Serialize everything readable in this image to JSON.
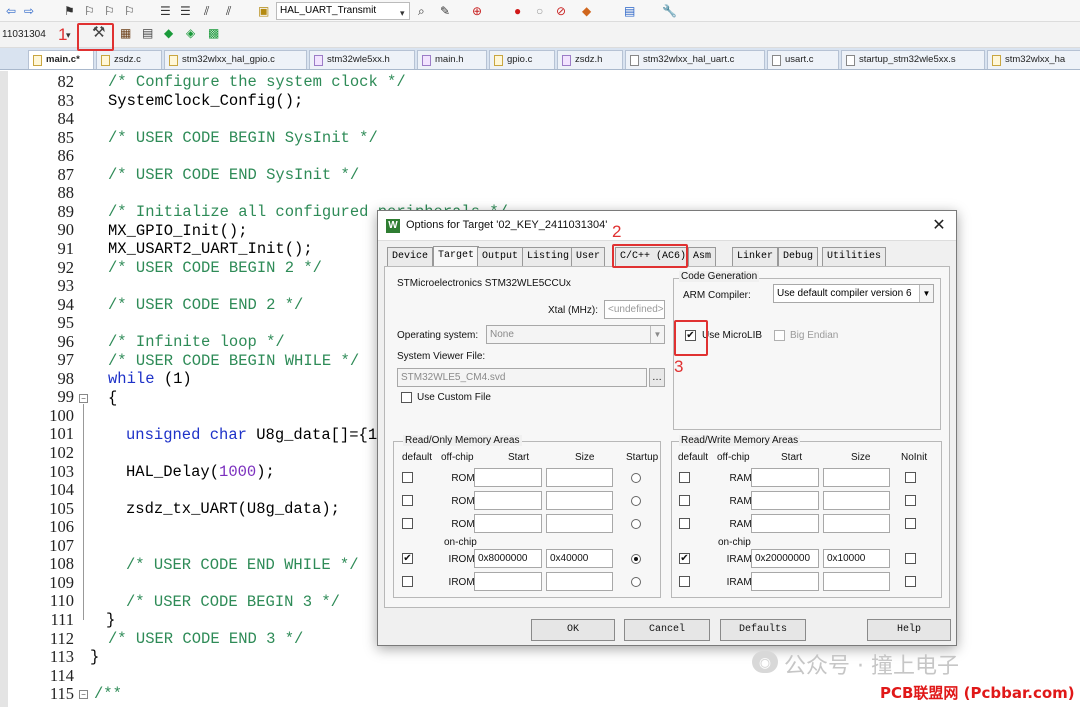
{
  "toolbar1": {
    "target_name": "HAL_UART_Transmit"
  },
  "toolbar2": {
    "target_combo": "11031304"
  },
  "file_tabs": [
    {
      "label": "main.c*",
      "type": "c",
      "active": true
    },
    {
      "label": "zsdz.c",
      "type": "c"
    },
    {
      "label": "stm32wlxx_hal_gpio.c",
      "type": "c"
    },
    {
      "label": "stm32wle5xx.h",
      "type": "h"
    },
    {
      "label": "main.h",
      "type": "h"
    },
    {
      "label": "gpio.c",
      "type": "c"
    },
    {
      "label": "zsdz.h",
      "type": "h"
    },
    {
      "label": "stm32wlxx_hal_uart.c",
      "type": "c"
    },
    {
      "label": "usart.c",
      "type": "c"
    },
    {
      "label": "startup_stm32wle5xx.s",
      "type": "s"
    },
    {
      "label": "stm32wlxx_ha",
      "type": "h"
    }
  ],
  "editor": {
    "line_numbers": [
      "82",
      "83",
      "84",
      "85",
      "86",
      "87",
      "88",
      "89",
      "90",
      "91",
      "92",
      "93",
      "94",
      "95",
      "96",
      "97",
      "98",
      "99",
      "100",
      "101",
      "102",
      "103",
      "104",
      "105",
      "106",
      "107",
      "108",
      "109",
      "110",
      "111",
      "112",
      "113",
      "114",
      "115"
    ],
    "lines": {
      "l82": "/* Configure the system clock */",
      "l83": "SystemClock_Config();",
      "l85": "/* USER CODE BEGIN SysInit */",
      "l87": "/* USER CODE END SysInit */",
      "l89": "/* Initialize all configured peripherals */",
      "l90": "MX_GPIO_Init();",
      "l91": "MX_USART2_UART_Init();",
      "l92": "/* USER CODE BEGIN 2 */",
      "l94": "/* USER CODE END 2 */",
      "l96": "/* Infinite loop */",
      "l97": "/* USER CODE BEGIN WHILE */",
      "l98_kw": "while",
      "l98_rest": " (1)",
      "l99": "{",
      "l101_kw": "unsigned char",
      "l101_rest": " U8g_data[]={1",
      "l103_fn": "HAL_Delay(",
      "l103_num": "1000",
      "l103_end": ");",
      "l105": "zsdz_tx_UART(U8g_data);",
      "l108": "/* USER CODE END WHILE */",
      "l110": "/* USER CODE BEGIN 3 */",
      "l111": "}",
      "l112": "/* USER CODE END 3 */",
      "l113": "}",
      "l115": "/**"
    }
  },
  "annotations": {
    "n1": "1",
    "n2": "2",
    "n3": "3"
  },
  "dialog": {
    "title": "Options for Target '02_KEY_2411031304'",
    "close": "✕",
    "tabs": [
      "Device",
      "Target",
      "Output",
      "Listing",
      "User",
      "C/C++ (AC6)",
      "Asm",
      "Linker",
      "Debug",
      "Utilities"
    ],
    "active_tab": "Target",
    "device_name": "STMicroelectronics STM32WLE5CCUx",
    "xtal_label": "Xtal (MHz):",
    "xtal_value": "<undefined>",
    "os_label": "Operating system:",
    "os_value": "None",
    "svf_label": "System Viewer File:",
    "svf_value": "STM32WLE5_CM4.svd",
    "custom_file_label": "Use Custom File",
    "code_gen": {
      "group_title": "Code Generation",
      "compiler_label": "ARM Compiler:",
      "compiler_value": "Use default compiler version 6",
      "microlib_label": "Use MicroLIB",
      "microlib_checked": true,
      "endian_label": "Big Endian"
    },
    "ro_mem": {
      "group_title": "Read/Only Memory Areas",
      "headers": {
        "default": "default",
        "offchip": "off-chip",
        "start": "Start",
        "size": "Size",
        "startup": "Startup"
      },
      "onchip_label": "on-chip",
      "rows": [
        {
          "name": "ROM1:",
          "start": "",
          "size": "",
          "default": false,
          "startup": false
        },
        {
          "name": "ROM2:",
          "start": "",
          "size": "",
          "default": false,
          "startup": false
        },
        {
          "name": "ROM3:",
          "start": "",
          "size": "",
          "default": false,
          "startup": false
        },
        {
          "name": "IROM1:",
          "start": "0x8000000",
          "size": "0x40000",
          "default": true,
          "startup": true
        },
        {
          "name": "IROM2:",
          "start": "",
          "size": "",
          "default": false,
          "startup": false
        }
      ]
    },
    "rw_mem": {
      "group_title": "Read/Write Memory Areas",
      "headers": {
        "default": "default",
        "offchip": "off-chip",
        "start": "Start",
        "size": "Size",
        "noinit": "NoInit"
      },
      "onchip_label": "on-chip",
      "rows": [
        {
          "name": "RAM1:",
          "start": "",
          "size": "",
          "default": false,
          "noinit": false
        },
        {
          "name": "RAM2:",
          "start": "",
          "size": "",
          "default": false,
          "noinit": false
        },
        {
          "name": "RAM3:",
          "start": "",
          "size": "",
          "default": false,
          "noinit": false
        },
        {
          "name": "IRAM1:",
          "start": "0x20000000",
          "size": "0x10000",
          "default": true,
          "noinit": false
        },
        {
          "name": "IRAM2:",
          "start": "",
          "size": "",
          "default": false,
          "noinit": false
        }
      ]
    },
    "buttons": {
      "ok": "OK",
      "cancel": "Cancel",
      "defaults": "Defaults",
      "help": "Help"
    }
  },
  "watermark": {
    "wechat": "公众号 · 撞上电子",
    "site": "PCB联盟网 (Pcbbar.com)"
  },
  "colors": {
    "annotation_red": "#e03131",
    "comment_green": "#2e8b57",
    "keyword_blue": "#1e32c8"
  }
}
